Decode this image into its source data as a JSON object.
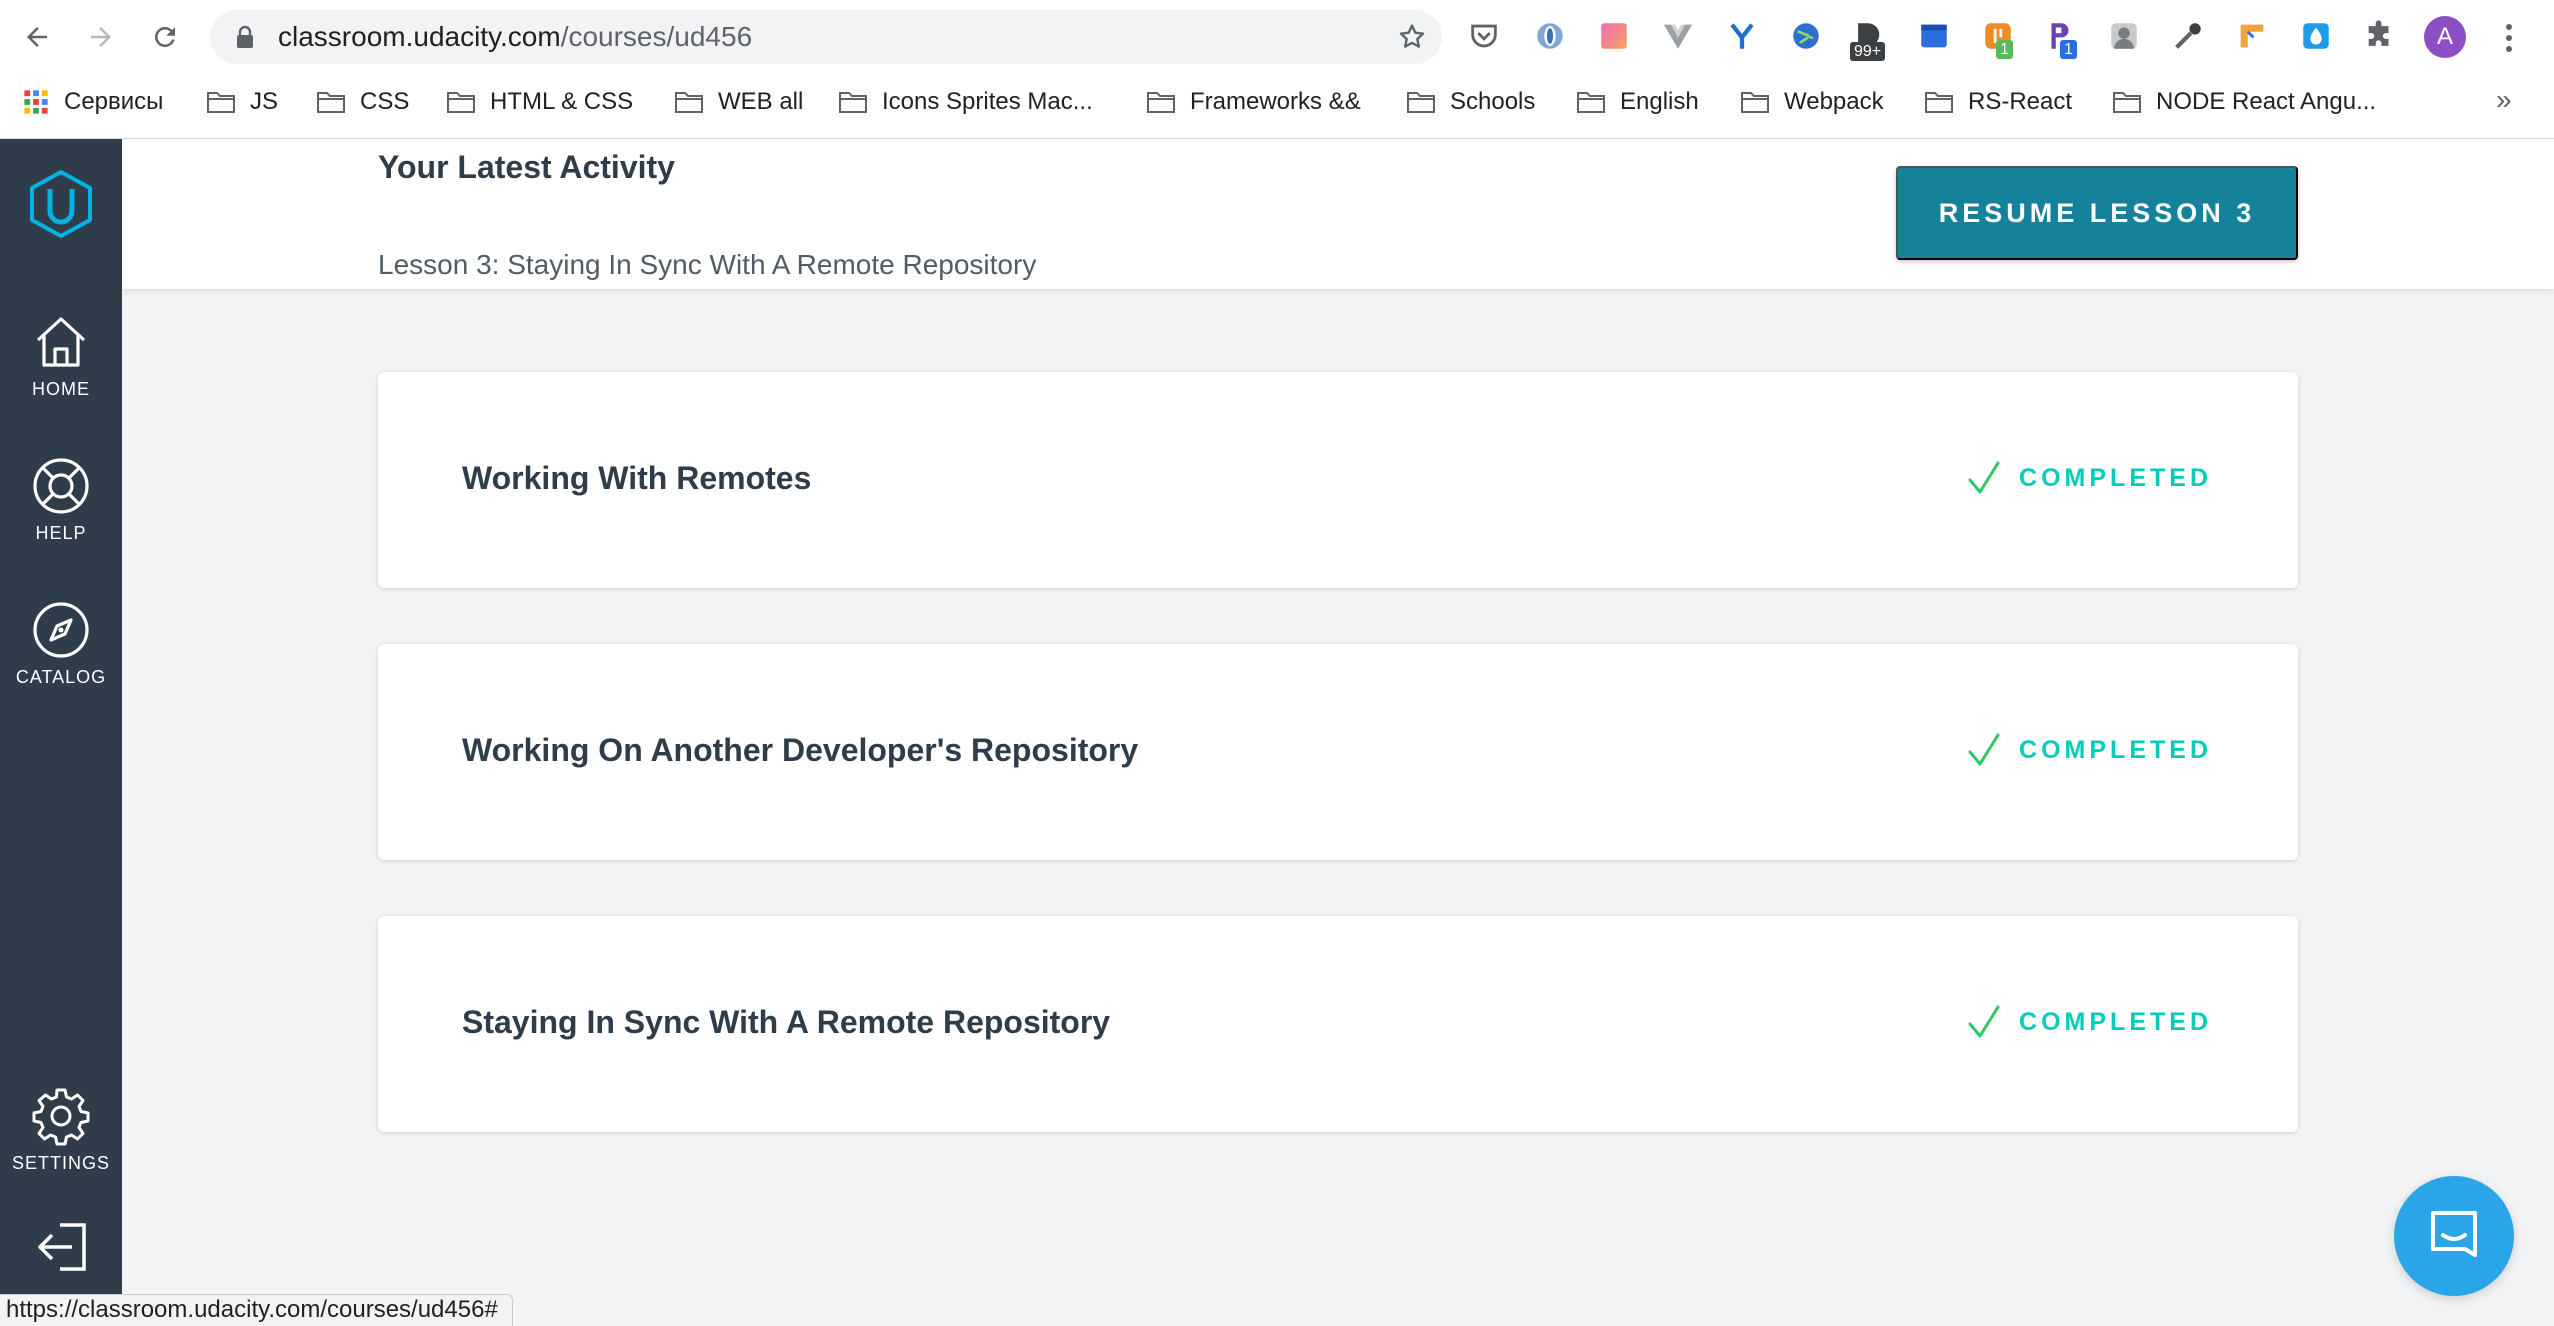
{
  "browser": {
    "url_host": "classroom.udacity.com",
    "url_path": "/courses/ud456",
    "status_url": "https://classroom.udacity.com/courses/ud456#",
    "avatar_letter": "A",
    "extensions": [
      {
        "icon": "pocket-icon"
      },
      {
        "icon": "opera-vpn-icon"
      },
      {
        "icon": "color-gradient-icon"
      },
      {
        "icon": "vuejs-devtools-icon"
      },
      {
        "icon": "yandex-icon"
      },
      {
        "icon": "globe-icon"
      },
      {
        "icon": "d-extension-icon",
        "badge": "99+"
      },
      {
        "icon": "blue-box-icon"
      },
      {
        "icon": "orange-extension-icon",
        "badge": "1"
      },
      {
        "icon": "purple-r-icon",
        "badge": "1"
      },
      {
        "icon": "gray-person-icon"
      },
      {
        "icon": "eyedropper-icon"
      },
      {
        "icon": "ruler-icon"
      },
      {
        "icon": "drop-icon"
      },
      {
        "icon": "puzzle-icon"
      }
    ],
    "bookmarks": [
      {
        "label": "Сервисы",
        "icon": "apps-grid-icon"
      },
      {
        "label": "JS",
        "icon": "folder-icon"
      },
      {
        "label": "CSS",
        "icon": "folder-icon"
      },
      {
        "label": "HTML & CSS",
        "icon": "folder-icon"
      },
      {
        "label": "WEB all",
        "icon": "folder-icon"
      },
      {
        "label": "Icons Sprites Mac...",
        "icon": "folder-icon"
      },
      {
        "label": "Frameworks &&",
        "icon": "folder-icon"
      },
      {
        "label": "Schools",
        "icon": "folder-icon"
      },
      {
        "label": "English",
        "icon": "folder-icon"
      },
      {
        "label": "Webpack",
        "icon": "folder-icon"
      },
      {
        "label": "RS-React",
        "icon": "folder-icon"
      },
      {
        "label": "NODE React Angu...",
        "icon": "folder-icon"
      }
    ],
    "bookmarks_more": "»"
  },
  "rail": {
    "items": [
      {
        "label": "HOME",
        "icon": "home-icon"
      },
      {
        "label": "HELP",
        "icon": "lifebuoy-icon"
      },
      {
        "label": "CATALOG",
        "icon": "compass-icon"
      },
      {
        "label": "SETTINGS",
        "icon": "gear-icon"
      }
    ],
    "logout_icon": "logout-icon"
  },
  "latest": {
    "title": "Your Latest Activity",
    "subtitle": "Lesson 3: Staying In Sync With A Remote Repository",
    "resume_label": "RESUME LESSON 3"
  },
  "lessons": [
    {
      "title": "Working With Remotes",
      "status": "COMPLETED"
    },
    {
      "title": "Working On Another Developer's Repository",
      "status": "COMPLETED"
    },
    {
      "title": "Staying In Sync With A Remote Repository",
      "status": "COMPLETED"
    }
  ],
  "colors": {
    "rail": "#2e3d49",
    "accent": "#15819a",
    "completed": "#02ccba",
    "chat": "#2aa5e7"
  }
}
